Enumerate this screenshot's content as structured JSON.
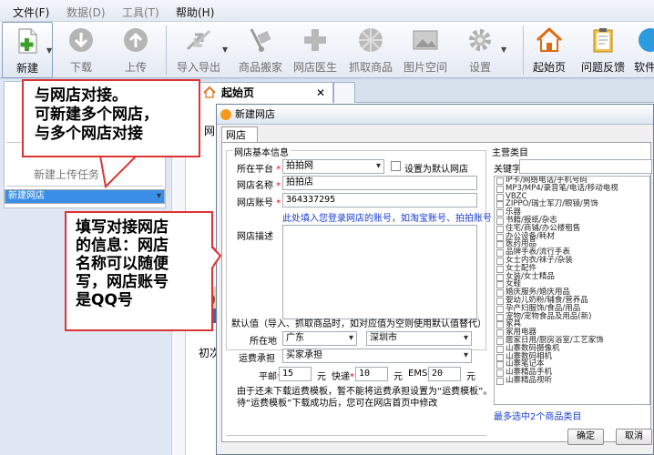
{
  "menu": [
    "文件(F)",
    "数据(D)",
    "工具(T)",
    "帮助(H)"
  ],
  "toolbar": {
    "new": "新建",
    "download": "下载",
    "upload": "上传",
    "import_export": "导入导出",
    "product_move": "商品搬家",
    "store_doctor": "网店医生",
    "grab": "抓取商品",
    "image_space": "图片空间",
    "settings": "设置",
    "home": "起始页",
    "feedback": "问题反馈",
    "software": "软件"
  },
  "left": {
    "upload_task": "新建上传任务",
    "new_store": "新建网店"
  },
  "tabs": {
    "home": "起始页"
  },
  "content": {
    "subtab_fragment": "网",
    "bg_text": "初次"
  },
  "callouts": {
    "c1": [
      "与网店对接。",
      "可新建多个网店，",
      "与多个网店对接"
    ],
    "c2": [
      "填写对接网店",
      "的信息：网店",
      "名称可以随便",
      "写，网店账号",
      "是QQ号"
    ]
  },
  "dialog": {
    "title": "新建网店",
    "tab": "网店",
    "basic_group": "网店基本信息",
    "platform_label": "所在平台",
    "platform_value": "拍拍网",
    "default_store_label": "设置为默认网店",
    "name_label": "网店名称",
    "name_value": "拍拍店",
    "account_label": "网店账号",
    "account_value": "364337295",
    "account_hint": "此处填入您登录网店的账号，如淘宝账号、拍拍账号",
    "desc_label": "网店描述",
    "defaults_group": "默认值（导入、抓取商品时，如对应值为空则使用默认值替代）",
    "location_label": "所在地",
    "province": "广东",
    "city": "深圳市",
    "shipping_label": "运费承担",
    "shipping_value": "买家承担",
    "mail_label": "平邮",
    "mail_value": "15",
    "express_label": "快递",
    "express_value": "10",
    "ems_label": "EMS",
    "ems_value": "20",
    "unit": "元",
    "hint1": "由于还未下载运费模板，暂不能将运费承担设置为“运费模板”。",
    "hint2": "待“运费模板”下载成功后，您可在网店首页中修改",
    "cat_group": "主营类目",
    "keyword_label": "关键字",
    "categories": [
      "IP卡/网络电话/手机号码",
      "MP3/MP4/录音笔/电话/移动电视",
      "VBZC",
      "ZIPPO/瑞士军刀/眼镜/男饰",
      "乐器",
      "书籍/报纸/杂志",
      "住宅/商铺/办公楼租售",
      "办公设备/耗材",
      "医药用品",
      "品牌手表/流行手表",
      "女士内衣/袜子/杂装",
      "女士配件",
      "女装/女士精品",
      "女鞋",
      "婚庆服务/婚庆用品",
      "婴幼儿奶粉/辅食/营养品",
      "孕产妇服饰/食品/用品",
      "宠物/宠物食品及用品(新)",
      "家具",
      "家用电器",
      "居家日用/厨房浴室/工艺家饰",
      "山寨数码摄像机",
      "山寨数码相机",
      "山寨笔记本",
      "山寨精品手机",
      "山寨精品视听"
    ],
    "cat_count": "最多选中2个商品类目",
    "ok": "确定",
    "cancel": "取消"
  }
}
